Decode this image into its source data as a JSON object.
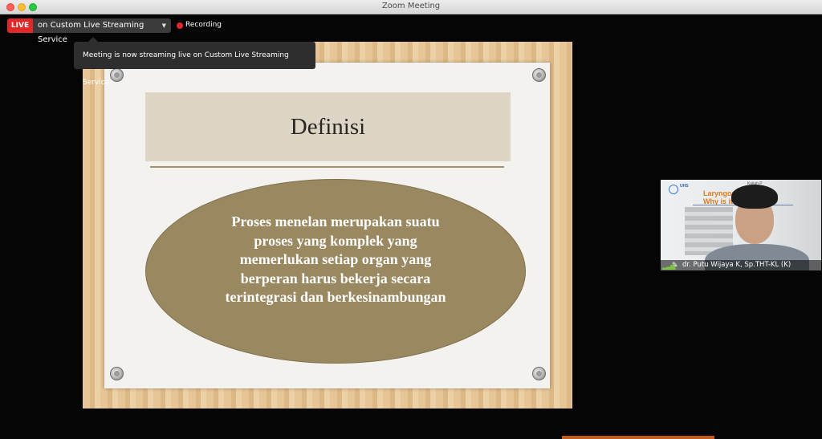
{
  "window": {
    "title": "Zoom Meeting"
  },
  "status_bar": {
    "live_label": "LIVE",
    "stream_target": "on Custom Live Streaming Service",
    "recording_label": "Recording"
  },
  "tooltip": {
    "text": "Meeting is now streaming live on Custom Live Streaming Service"
  },
  "slide": {
    "title": "Definisi",
    "body_lines": [
      "Proses menelan merupakan suatu",
      "proses yang komplek yang",
      "memerlukan setiap organ yang",
      "berperan harus bekerja secara",
      "terintegrasi dan berkesinambungan"
    ]
  },
  "participant": {
    "name": "dr. Putu Wijaya K, Sp.THT-KL (K)",
    "thumb_line1": "Laryngoph",
    "thumb_line2": "Why is it",
    "thumb_line3": "Kuliah P",
    "thumb_logo_text": "UHS"
  },
  "colors": {
    "live_red": "#e02828",
    "slide_ellipse": "#9a8860",
    "title_band": "#ddd6c6",
    "wood": "#e6c596"
  }
}
